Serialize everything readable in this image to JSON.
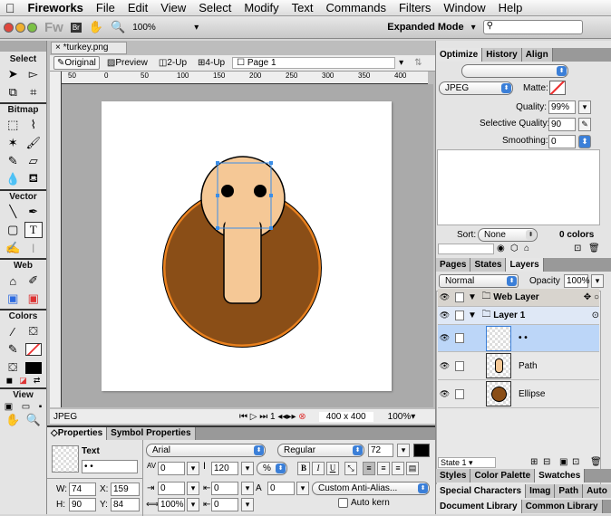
{
  "menubar": {
    "apple": "",
    "items": [
      "Fireworks",
      "File",
      "Edit",
      "View",
      "Select",
      "Modify",
      "Text",
      "Commands",
      "Filters",
      "Window",
      "Help"
    ]
  },
  "toolbar": {
    "logo": "Fw",
    "bridge": "Br",
    "zoom": "100%",
    "mode": "Expanded Mode",
    "search_placeholder": ""
  },
  "tools": {
    "sections": [
      "Select",
      "Bitmap",
      "Vector",
      "Web",
      "Colors",
      "View"
    ]
  },
  "document": {
    "tab": "*turkey.png",
    "views": [
      "Original",
      "Preview",
      "2-Up",
      "4-Up"
    ],
    "page": "Page 1",
    "ruler": [
      "50",
      "0",
      "50",
      "100",
      "150",
      "200",
      "250",
      "300",
      "350",
      "400"
    ],
    "status": {
      "format": "JPEG",
      "frame": "1",
      "size": "400 x 400",
      "zoom": "100%"
    },
    "colors": {
      "body": "#8a4e17",
      "body_stroke": "#e8801e",
      "head": "#f5c896",
      "selection": "#3b8ee8"
    }
  },
  "optimize": {
    "tabs": [
      "Optimize",
      "History",
      "Align"
    ],
    "preset": "",
    "format": "JPEG",
    "matte_label": "Matte:",
    "quality_label": "Quality:",
    "quality": "99%",
    "selective_label": "Selective Quality:",
    "selective": "90",
    "smoothing_label": "Smoothing:",
    "smoothing": "0",
    "sort_label": "Sort:",
    "sort": "None",
    "colors": "0 colors"
  },
  "layers": {
    "tabs": [
      "Pages",
      "States",
      "Layers"
    ],
    "blend": "Normal",
    "opacity_label": "Opacity",
    "opacity": "100%",
    "rows": [
      {
        "name": "Web Layer"
      },
      {
        "name": "Layer 1"
      },
      {
        "name": "• •"
      },
      {
        "name": "Path"
      },
      {
        "name": "Ellipse"
      }
    ],
    "state": "State 1"
  },
  "bottom_panels": {
    "row1": [
      "Styles",
      "Color Palette",
      "Swatches"
    ],
    "row2": [
      "Special Characters",
      "Imag",
      "Path",
      "Auto"
    ],
    "row3": [
      "Document Library",
      "Common Library"
    ]
  },
  "properties": {
    "tabs": [
      "Properties",
      "Symbol Properties"
    ],
    "type": "Text",
    "name": "• •",
    "w_label": "W:",
    "w": "74",
    "x_label": "X:",
    "x": "159",
    "h_label": "H:",
    "h": "90",
    "y_label": "Y:",
    "y": "84",
    "font": "Arial",
    "style": "Regular",
    "size": "72",
    "kerning": "0",
    "leading": "120",
    "leading_unit": "%",
    "indent": "0",
    "space_before": "0",
    "baseline": "0",
    "scale": "100%",
    "space_after": "0",
    "antialias": "Custom Anti-Alias...",
    "autokern": "Auto kern",
    "bold": "B",
    "italic": "I",
    "underline": "U"
  }
}
